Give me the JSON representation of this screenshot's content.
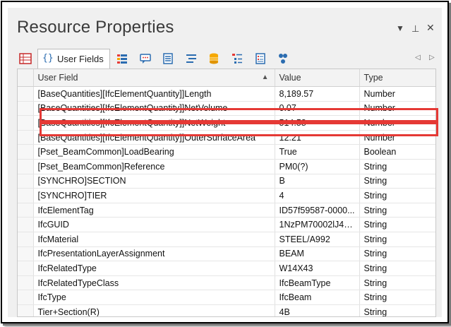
{
  "window": {
    "title": "Resource Properties"
  },
  "toolbar": {
    "active_tab_label": "User Fields",
    "icons": [
      "properties-grid-icon",
      "user-fields-icon",
      "bar-list-icon",
      "comment-icon",
      "list-icon",
      "align-icon",
      "database-stack-icon",
      "tree-list-icon",
      "form-icon",
      "link-nodes-icon"
    ]
  },
  "table": {
    "headers": {
      "field": "User Field",
      "value": "Value",
      "type": "Type"
    },
    "rows": [
      {
        "field": "[BaseQuantities][IfcElementQuantity]]Length",
        "value": "8,189.57",
        "type": "Number"
      },
      {
        "field": "[BaseQuantities][IfcElementQuantity]]NetVolume",
        "value": "0.07",
        "type": "Number"
      },
      {
        "field": "[BaseQuantities][IfcElementQuantity]]NetWeight",
        "value": "514.58",
        "type": "Number"
      },
      {
        "field": "[BaseQuantities][IfcElementQuantity]]OuterSurfaceArea",
        "value": "12.21",
        "type": "Number"
      },
      {
        "field": "[Pset_BeamCommon]LoadBearing",
        "value": "True",
        "type": "Boolean"
      },
      {
        "field": "[Pset_BeamCommon]Reference",
        "value": "PM0(?)",
        "type": "String"
      },
      {
        "field": "[SYNCHRO]SECTION",
        "value": "B",
        "type": "String"
      },
      {
        "field": "[SYNCHRO]TIER",
        "value": "4",
        "type": "String"
      },
      {
        "field": "IfcElementTag",
        "value": "ID57f59587-0000...",
        "type": "String"
      },
      {
        "field": "IfcGUID",
        "value": "1NzPM70002lJ4q...",
        "type": "String"
      },
      {
        "field": "IfcMaterial",
        "value": "STEEL/A992",
        "type": "String"
      },
      {
        "field": "IfcPresentationLayerAssignment",
        "value": "BEAM",
        "type": "String"
      },
      {
        "field": "IfcRelatedType",
        "value": "W14X43",
        "type": "String"
      },
      {
        "field": "IfcRelatedTypeClass",
        "value": "IfcBeamType",
        "type": "String"
      },
      {
        "field": "IfcType",
        "value": "IfcBeam",
        "type": "String"
      },
      {
        "field": "Tier+Section(R)",
        "value": "4B",
        "type": "String"
      }
    ]
  },
  "highlight": {
    "color": "#e53935"
  }
}
